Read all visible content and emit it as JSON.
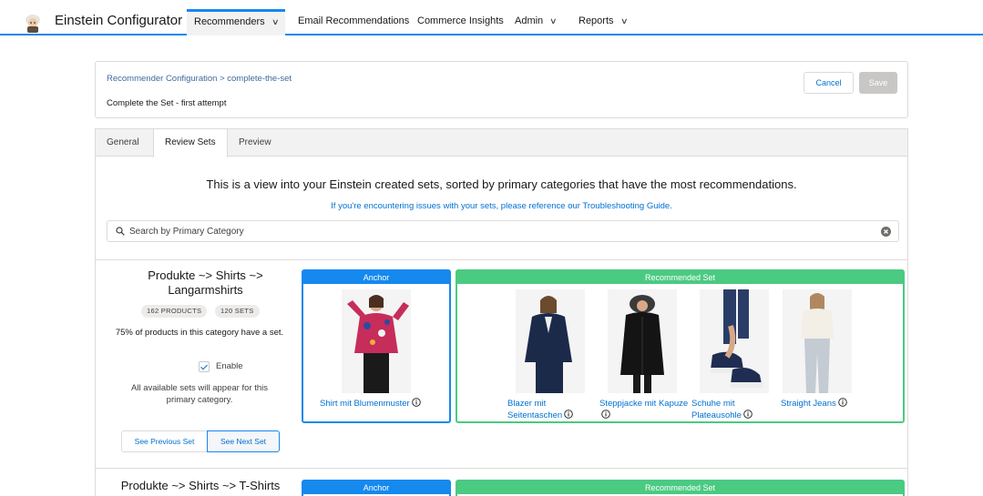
{
  "nav": {
    "app_title": "Einstein Configurator",
    "items": [
      {
        "label": "Recommenders",
        "dropdown": true,
        "active": true
      },
      {
        "label": "Email Recommendations",
        "dropdown": false
      },
      {
        "label": "Commerce Insights",
        "dropdown": false
      },
      {
        "label": "Admin",
        "dropdown": true
      },
      {
        "label": "Reports",
        "dropdown": true
      }
    ]
  },
  "header": {
    "breadcrumb": "Recommender Configuration > complete-the-set",
    "record_name": "Complete the Set - first attempt",
    "cancel_label": "Cancel",
    "save_label": "Save"
  },
  "tabs": [
    {
      "label": "General"
    },
    {
      "label": "Review Sets",
      "active": true
    },
    {
      "label": "Preview"
    }
  ],
  "review": {
    "intro": "This is a view into your Einstein created sets, sorted by primary categories that have the most recommendations.",
    "help_link": "If you're encountering issues with your sets, please reference our Troubleshooting Guide.",
    "search_placeholder": "Search by Primary Category"
  },
  "sets": [
    {
      "category": "Produkte ~> Shirts ~> Langarmshirts",
      "products_badge": "162 PRODUCTS",
      "sets_badge": "120 SETS",
      "coverage": "75% of products in this category have a set.",
      "enable_label": "Enable",
      "enabled": true,
      "note": "All available sets will appear for this primary category.",
      "prev_label": "See Previous Set",
      "next_label": "See Next Set",
      "anchor_label": "Anchor",
      "recommended_label": "Recommended Set",
      "anchor": {
        "name": "Shirt mit Blumenmuster"
      },
      "recommended": [
        {
          "name": "Blazer mit Seitentaschen"
        },
        {
          "name": "Steppjacke mit Kapuze"
        },
        {
          "name": "Schuhe mit Plateausohle"
        },
        {
          "name": "Straight Jeans"
        }
      ]
    },
    {
      "category": "Produkte ~> Shirts ~> T-Shirts",
      "anchor_label": "Anchor",
      "recommended_label": "Recommended Set"
    }
  ],
  "colors": {
    "brand_blue": "#1589ee",
    "link_blue": "#0070d2",
    "success_green": "#4bca81"
  }
}
